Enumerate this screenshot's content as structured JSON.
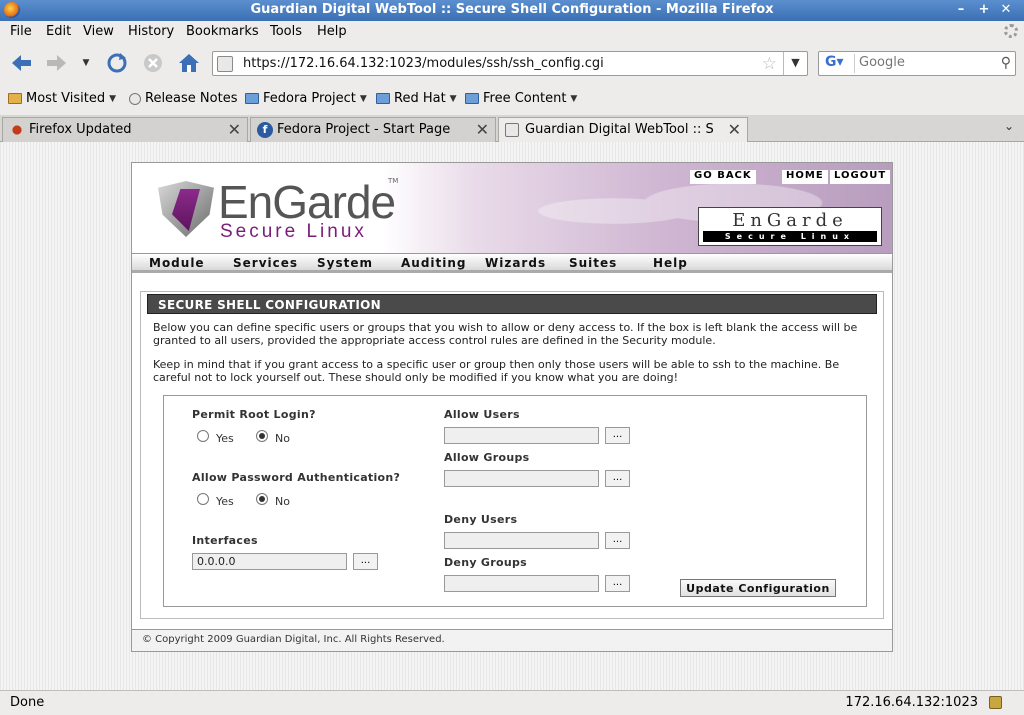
{
  "window": {
    "title": "Guardian Digital WebTool :: Secure Shell Configuration - Mozilla Firefox"
  },
  "menu": [
    "File",
    "Edit",
    "View",
    "History",
    "Bookmarks",
    "Tools",
    "Help"
  ],
  "nav": {
    "url": "https://172.16.64.132:1023/modules/ssh/ssh_config.cgi",
    "search_placeholder": "Google"
  },
  "bookmarks": [
    "Most Visited",
    "Release Notes",
    "Fedora Project",
    "Red Hat",
    "Free Content"
  ],
  "tabs": [
    "Firefox Updated",
    "Fedora Project - Start Page",
    "Guardian Digital WebTool :: S..."
  ],
  "banner": {
    "brand": "EnGarde",
    "tagline": "Secure Linux",
    "tm": "TM",
    "go_back": "GO BACK",
    "home": "HOME",
    "logout": "LOGOUT",
    "badge_top": "EnGarde",
    "badge_bottom": "Secure Linux"
  },
  "topnav": [
    "Module",
    "Services",
    "System",
    "Auditing",
    "Wizards",
    "Suites",
    "Help"
  ],
  "section": {
    "title": "SECURE SHELL CONFIGURATION",
    "desc1": "Below you can define specific users or groups that you wish to allow or deny access to. If the box is left blank the access will be granted to all users, provided the appropriate access control rules are defined in the Security module.",
    "desc2": "Keep in mind that if you grant access to a specific user or group then only those users will be able to ssh to the machine. Be careful not to lock yourself out. These should only be modified if you know what you are doing!"
  },
  "form": {
    "permit_root": "Permit Root Login?",
    "allow_password": "Allow Password Authentication?",
    "yes": "Yes",
    "no": "No",
    "interfaces": "Interfaces",
    "interfaces_value": "0.0.0.0",
    "allow_users": "Allow Users",
    "allow_groups": "Allow Groups",
    "deny_users": "Deny Users",
    "deny_groups": "Deny Groups",
    "dots": "...",
    "update": "Update Configuration",
    "permit_root_value": "No",
    "allow_password_value": "No"
  },
  "footer": "© Copyright 2009 Guardian Digital, Inc. All Rights Reserved.",
  "status": {
    "text": "Done",
    "host": "172.16.64.132:1023"
  }
}
